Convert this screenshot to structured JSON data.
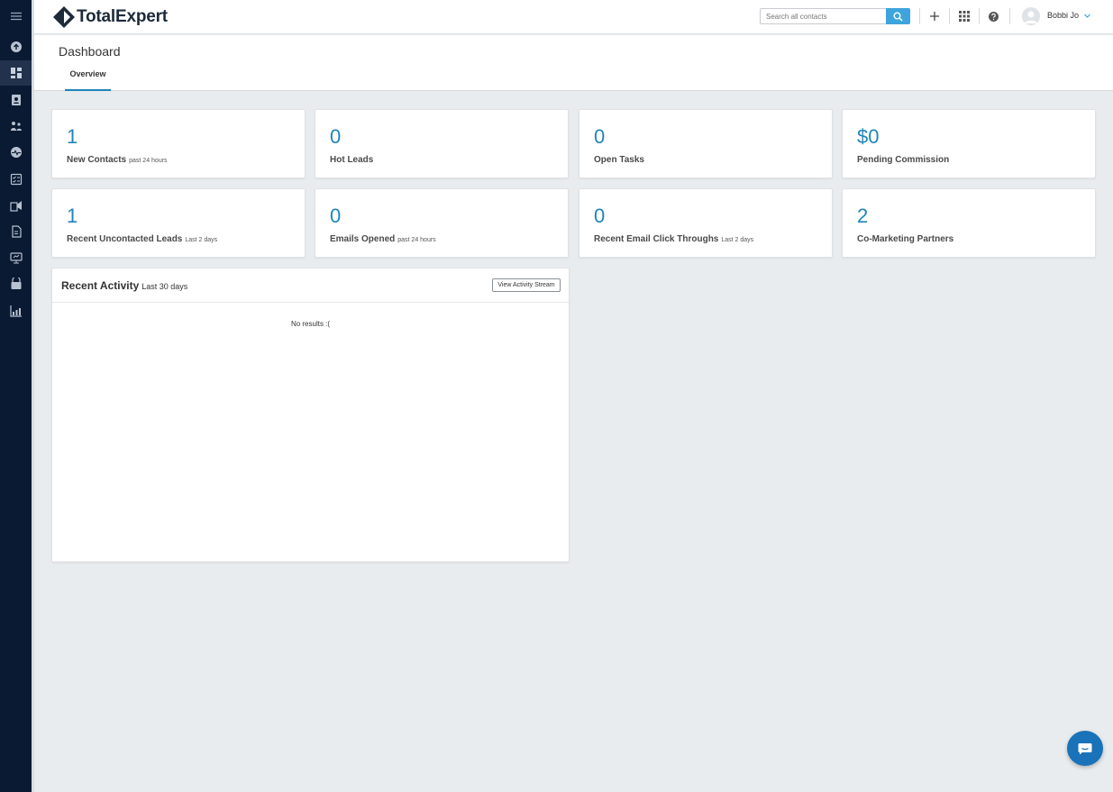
{
  "app": {
    "logo_text": "TotalExpert"
  },
  "header": {
    "search_placeholder": "Search all contacts",
    "user_name": "Bobbi Jo"
  },
  "page": {
    "title": "Dashboard",
    "tab": "Overview"
  },
  "stats": [
    {
      "value": "1",
      "label": "New Contacts",
      "sub": "past 24 hours"
    },
    {
      "value": "0",
      "label": "Hot Leads",
      "sub": ""
    },
    {
      "value": "0",
      "label": "Open Tasks",
      "sub": ""
    },
    {
      "value": "$0",
      "label": "Pending Commission",
      "sub": ""
    },
    {
      "value": "1",
      "label": "Recent Uncontacted Leads",
      "sub": "Last 2 days"
    },
    {
      "value": "0",
      "label": "Emails Opened",
      "sub": "past 24 hours"
    },
    {
      "value": "0",
      "label": "Recent Email Click Throughs",
      "sub": "Last 2 days"
    },
    {
      "value": "2",
      "label": "Co-Marketing Partners",
      "sub": ""
    }
  ],
  "activity": {
    "title": "Recent Activity",
    "sub": "Last 30 days",
    "button": "View Activity Stream",
    "empty": "No results :("
  },
  "colors": {
    "accent": "#1f85b9",
    "sidebar": "#0b1a33",
    "search_button": "#3ea4dc",
    "chat": "#1a72b8"
  },
  "sidebar_icons": [
    "menu-icon",
    "upload-icon",
    "dashboard-icon",
    "contacts-icon",
    "network-icon",
    "pulse-icon",
    "tasks-icon",
    "marketing-icon",
    "documents-icon",
    "presentation-icon",
    "store-icon",
    "reports-icon"
  ]
}
